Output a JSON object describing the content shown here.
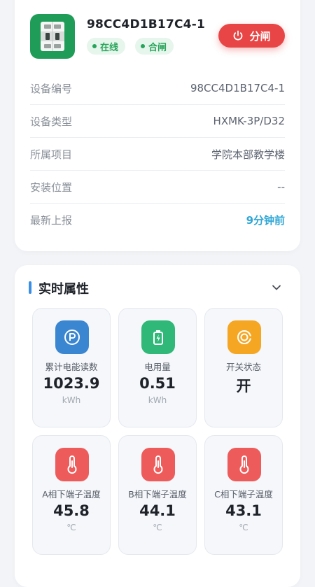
{
  "device": {
    "name": "98CC4D1B17C4-1",
    "status_online": "在线",
    "status_switch": "合闸",
    "action_button": "分闸",
    "icon": "circuit-breaker-icon",
    "fields": [
      {
        "label": "设备编号",
        "value": "98CC4D1B17C4-1"
      },
      {
        "label": "设备类型",
        "value": "HXMK-3P/D32"
      },
      {
        "label": "所属项目",
        "value": "学院本部教学楼"
      },
      {
        "label": "安装位置",
        "value": "--"
      },
      {
        "label": "最新上报",
        "value": "9分钟前"
      }
    ]
  },
  "realtime": {
    "title": "实时属性",
    "collapse_icon": "chevron-down-icon",
    "tiles": [
      {
        "label": "累计电能读数",
        "value": "1023.9",
        "unit": "kWh",
        "icon": "power-meter-icon",
        "color": "#3a86d1"
      },
      {
        "label": "电用量",
        "value": "0.51",
        "unit": "kWh",
        "icon": "battery-charge-icon",
        "color": "#2fb878"
      },
      {
        "label": "开关状态",
        "value": "开",
        "unit": "",
        "icon": "switch-status-icon",
        "color": "#f5a623"
      },
      {
        "label": "A相下端子温度",
        "value": "45.8",
        "unit": "℃",
        "icon": "thermometer-icon",
        "color": "#ee5b5b"
      },
      {
        "label": "B相下端子温度",
        "value": "44.1",
        "unit": "℃",
        "icon": "thermometer-icon",
        "color": "#ee5b5b"
      },
      {
        "label": "C相下端子温度",
        "value": "43.1",
        "unit": "℃",
        "icon": "thermometer-icon",
        "color": "#ee5b5b"
      }
    ]
  },
  "colors": {
    "accent": "#2ea7d6",
    "online": "#27a35a",
    "danger": "#e84646",
    "section_bar": "#3a8ee6"
  }
}
